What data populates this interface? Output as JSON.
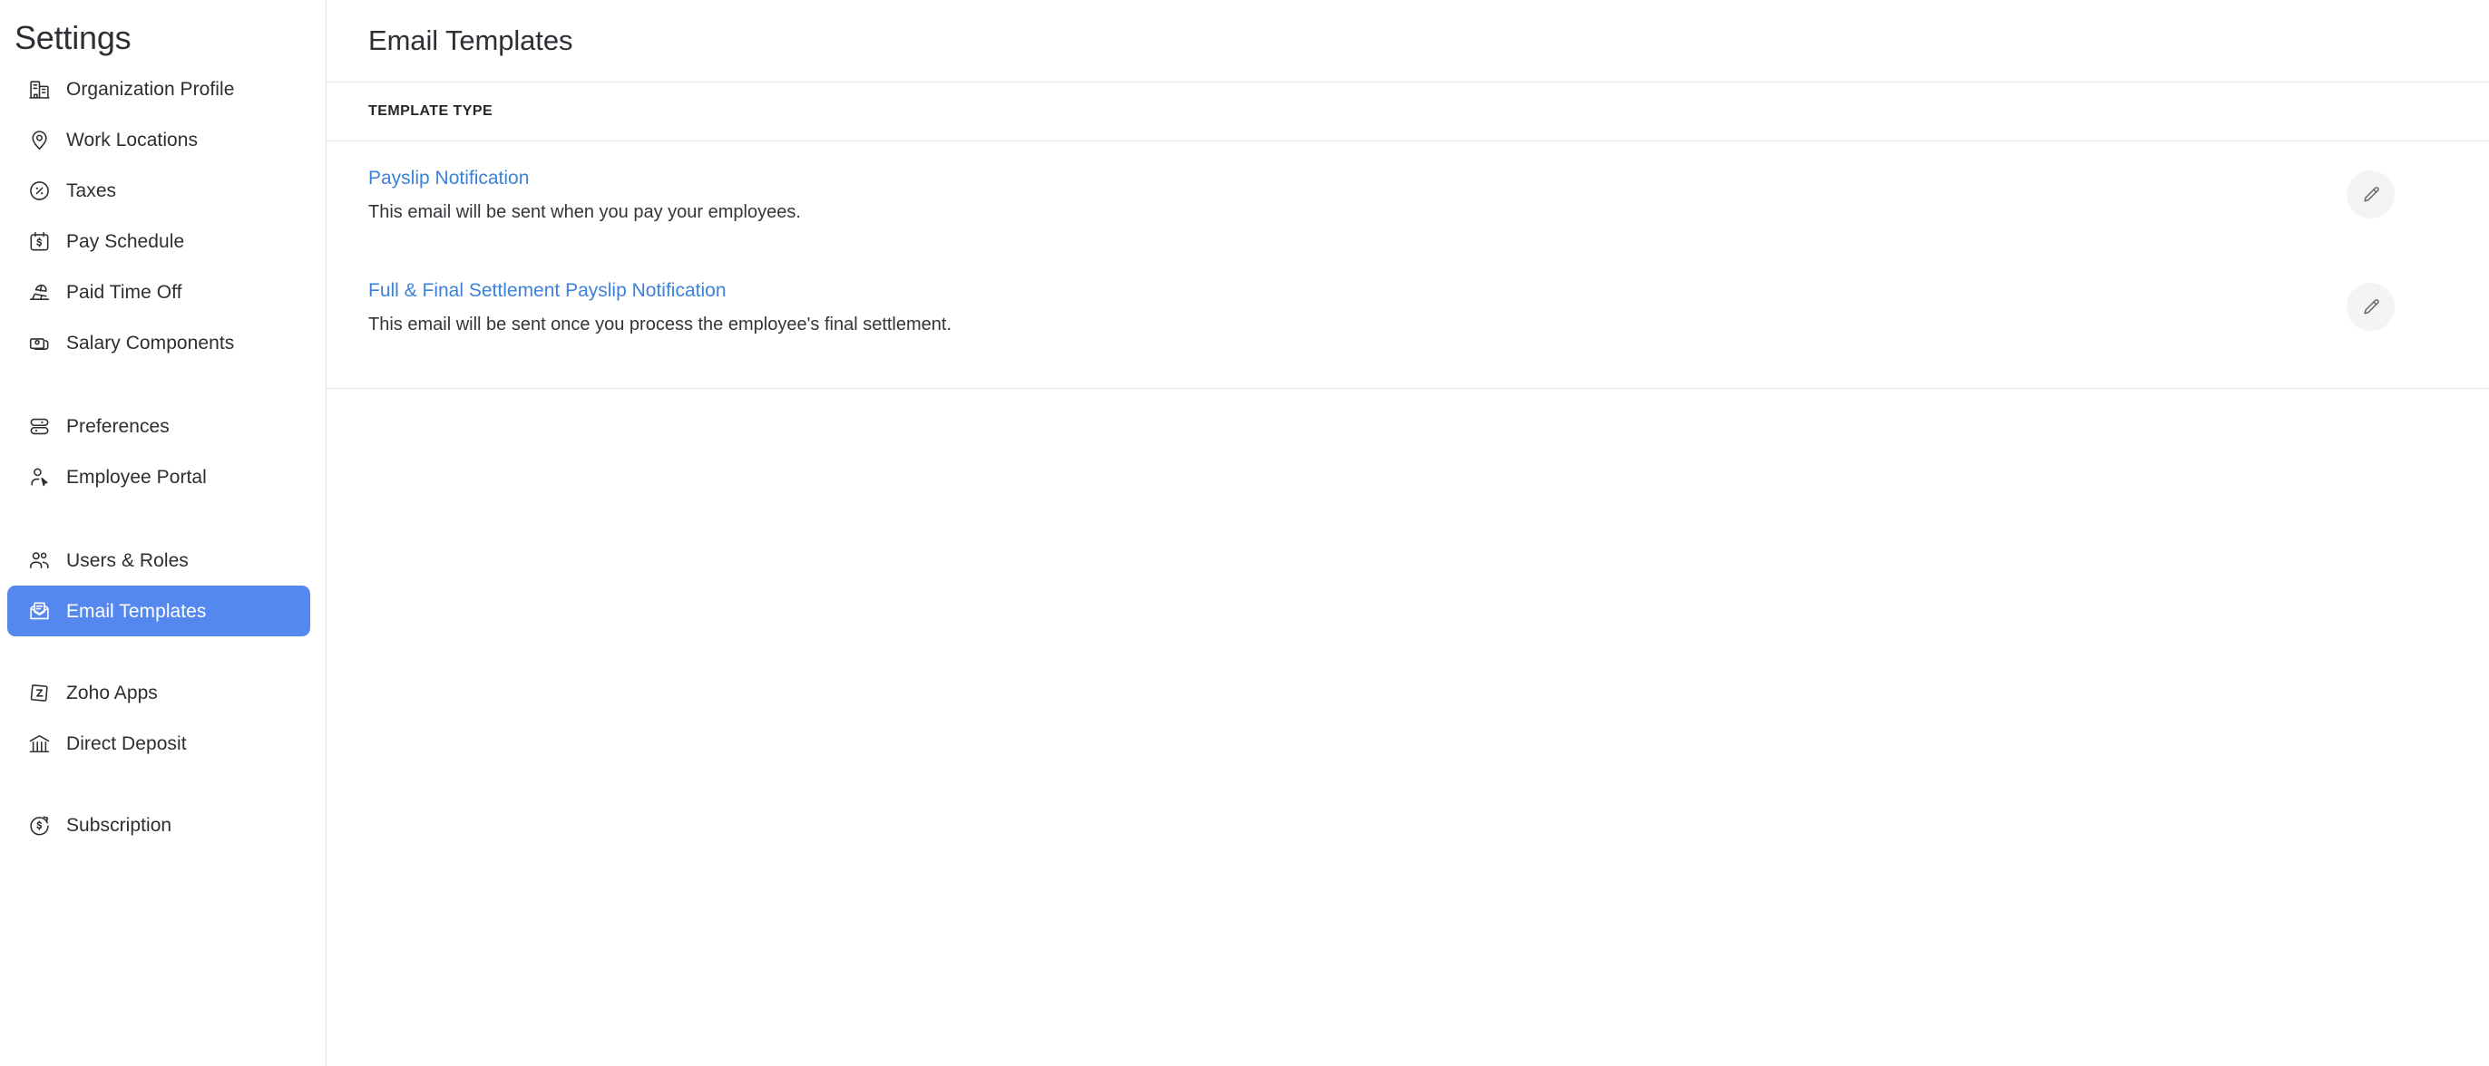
{
  "sidebar": {
    "title": "Settings",
    "groups": [
      {
        "items": [
          {
            "label": "Organization Profile",
            "icon": "building-icon",
            "active": false
          },
          {
            "label": "Work Locations",
            "icon": "map-pin-icon",
            "active": false
          },
          {
            "label": "Taxes",
            "icon": "percent-circle-icon",
            "active": false
          },
          {
            "label": "Pay Schedule",
            "icon": "calendar-dollar-icon",
            "active": false
          },
          {
            "label": "Paid Time Off",
            "icon": "beach-chair-icon",
            "active": false
          },
          {
            "label": "Salary Components",
            "icon": "cards-stack-icon",
            "active": false
          }
        ]
      },
      {
        "items": [
          {
            "label": "Preferences",
            "icon": "sliders-icon",
            "active": false
          },
          {
            "label": "Employee Portal",
            "icon": "user-cursor-icon",
            "active": false
          }
        ]
      },
      {
        "items": [
          {
            "label": "Users & Roles",
            "icon": "users-icon",
            "active": false
          },
          {
            "label": "Email Templates",
            "icon": "envelope-icon",
            "active": true
          }
        ]
      },
      {
        "items": [
          {
            "label": "Zoho Apps",
            "icon": "zoho-square-icon",
            "active": false
          },
          {
            "label": "Direct Deposit",
            "icon": "bank-icon",
            "active": false
          }
        ]
      },
      {
        "items": [
          {
            "label": "Subscription",
            "icon": "dollar-refresh-icon",
            "active": false
          }
        ]
      }
    ]
  },
  "header": {
    "title": "Email Templates"
  },
  "table": {
    "columns": [
      "TEMPLATE TYPE"
    ],
    "rows": [
      {
        "name": "Payslip Notification",
        "description": "This email will be sent when you pay your employees.",
        "action_icon": "pencil-icon"
      },
      {
        "name": "Full & Final Settlement Payslip Notification",
        "description": "This email will be sent once you process the employee's final settlement.",
        "action_icon": "pencil-icon"
      }
    ]
  },
  "colors": {
    "accent_blue": "#5488ef",
    "link_blue": "#3d82d9",
    "text_dark": "#2c2f33",
    "border": "#e8eaec",
    "icon_button_bg": "#f4f4f5"
  }
}
